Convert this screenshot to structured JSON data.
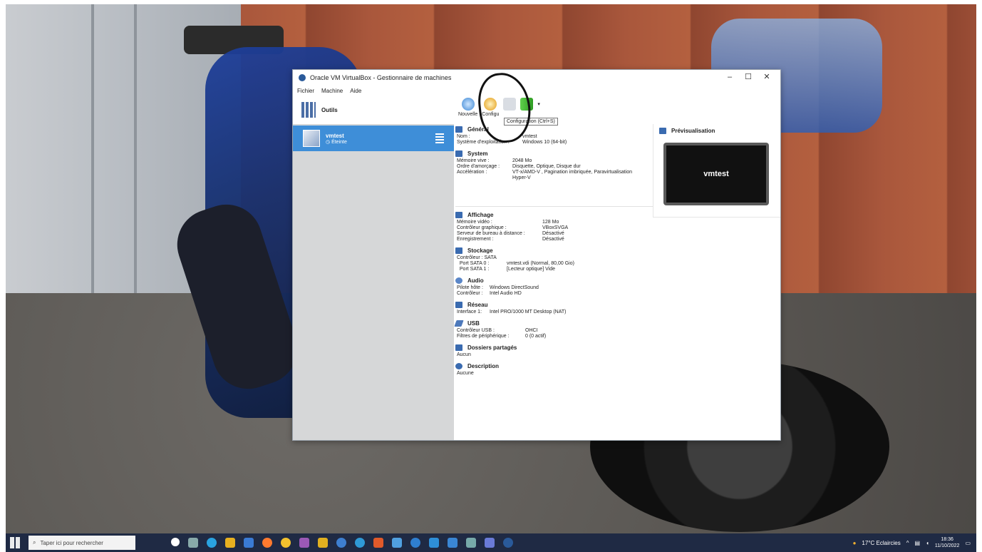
{
  "window": {
    "title": "Oracle VM VirtualBox - Gestionnaire de machines",
    "menu": [
      "Fichier",
      "Machine",
      "Aide"
    ]
  },
  "left": {
    "tools_label": "Outils",
    "vm_name": "vmtest",
    "vm_state": "Éteinte"
  },
  "toolbar": {
    "new_label": "Nouvelle",
    "config_label": "Configu",
    "tooltip": "Configuration (Ctrl+S)"
  },
  "details": {
    "general": {
      "title": "Général",
      "rows": [
        {
          "k": "Nom :",
          "v": "vmtest"
        },
        {
          "k": "Système d'exploitation :",
          "v": "Windows 10 (64-bit)"
        }
      ]
    },
    "system": {
      "title": "System",
      "rows": [
        {
          "k": "Mémoire vive :",
          "v": "2048 Mo"
        },
        {
          "k": "Ordre d'amorçage :",
          "v": "Disquette, Optique, Disque dur"
        },
        {
          "k": "Accélération :",
          "v": "VT-x/AMD-V , Pagination imbriquée, Paravirtualisation"
        },
        {
          "k": "",
          "v": "Hyper-V"
        }
      ]
    },
    "preview": {
      "title": "Prévisualisation",
      "screen_text": "vmtest"
    },
    "display": {
      "title": "Affichage",
      "rows": [
        {
          "k": "Mémoire vidéo :",
          "v": "128 Mo"
        },
        {
          "k": "Contrôleur graphique :",
          "v": "VBoxSVGA"
        },
        {
          "k": "Serveur de bureau à distance :",
          "v": "Désactivé"
        },
        {
          "k": "Enregistrement :",
          "v": "Désactivé"
        }
      ]
    },
    "storage": {
      "title": "Stockage",
      "rows": [
        {
          "k": "Contrôleur : SATA",
          "v": ""
        },
        {
          "k": "  Port SATA 0 :",
          "v": "vmtest.vdi (Normal, 80,00 Gio)"
        },
        {
          "k": "  Port SATA 1 :",
          "v": "[Lecteur optique] Vide"
        }
      ]
    },
    "audio": {
      "title": "Audio",
      "rows": [
        {
          "k": "Pilote hôte :",
          "v": "Windows DirectSound"
        },
        {
          "k": "Contrôleur :",
          "v": "Intel Audio HD"
        }
      ]
    },
    "network": {
      "title": "Réseau",
      "rows": [
        {
          "k": "Interface 1:",
          "v": "Intel PRO/1000 MT Desktop (NAT)"
        }
      ]
    },
    "usb": {
      "title": "USB",
      "rows": [
        {
          "k": "Contrôleur USB :",
          "v": "OHCI"
        },
        {
          "k": "Filtres de périphérique :",
          "v": "0 (0 actif)"
        }
      ]
    },
    "shared": {
      "title": "Dossiers partagés",
      "value": "Aucun"
    },
    "description": {
      "title": "Description",
      "value": "Aucune"
    }
  },
  "taskbar": {
    "search_placeholder": "Taper ici pour rechercher",
    "weather": "17°C Eclaircies",
    "time": "18:36",
    "date": "11/10/2022"
  }
}
